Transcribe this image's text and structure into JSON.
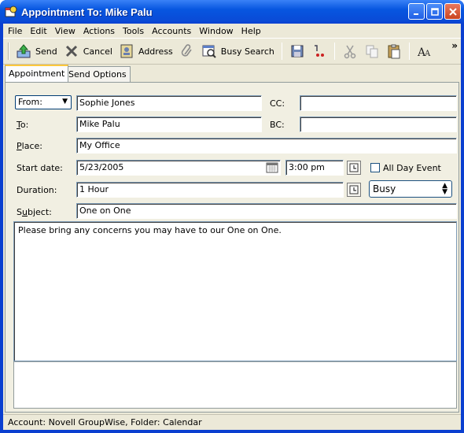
{
  "window": {
    "title": "Appointment To: Mike Palu"
  },
  "menu": [
    "File",
    "Edit",
    "View",
    "Actions",
    "Tools",
    "Accounts",
    "Window",
    "Help"
  ],
  "toolbar": {
    "send": "Send",
    "cancel": "Cancel",
    "address": "Address",
    "busy_search": "Busy Search"
  },
  "tabs": {
    "appointment": "Appointment",
    "send_options": "Send Options"
  },
  "form": {
    "from_button": "From:",
    "from_value": "Sophie Jones",
    "cc_label": "CC:",
    "cc_value": "",
    "to_label": "To:",
    "to_value": "Mike Palu",
    "bc_label": "BC:",
    "bc_value": "",
    "place_label": "Place:",
    "place_value": "My Office",
    "start_date_label": "Start date:",
    "start_date_value": "5/23/2005",
    "start_time_value": "3:00 pm",
    "all_day_label": "All Day Event",
    "all_day_checked": false,
    "duration_label": "Duration:",
    "duration_value": "1 Hour",
    "busy_value": "Busy",
    "subject_label": "Subject:",
    "subject_value": "One on One",
    "message": "Please bring any concerns you may have to our One on One."
  },
  "status": "Account: Novell GroupWise,  Folder: Calendar"
}
